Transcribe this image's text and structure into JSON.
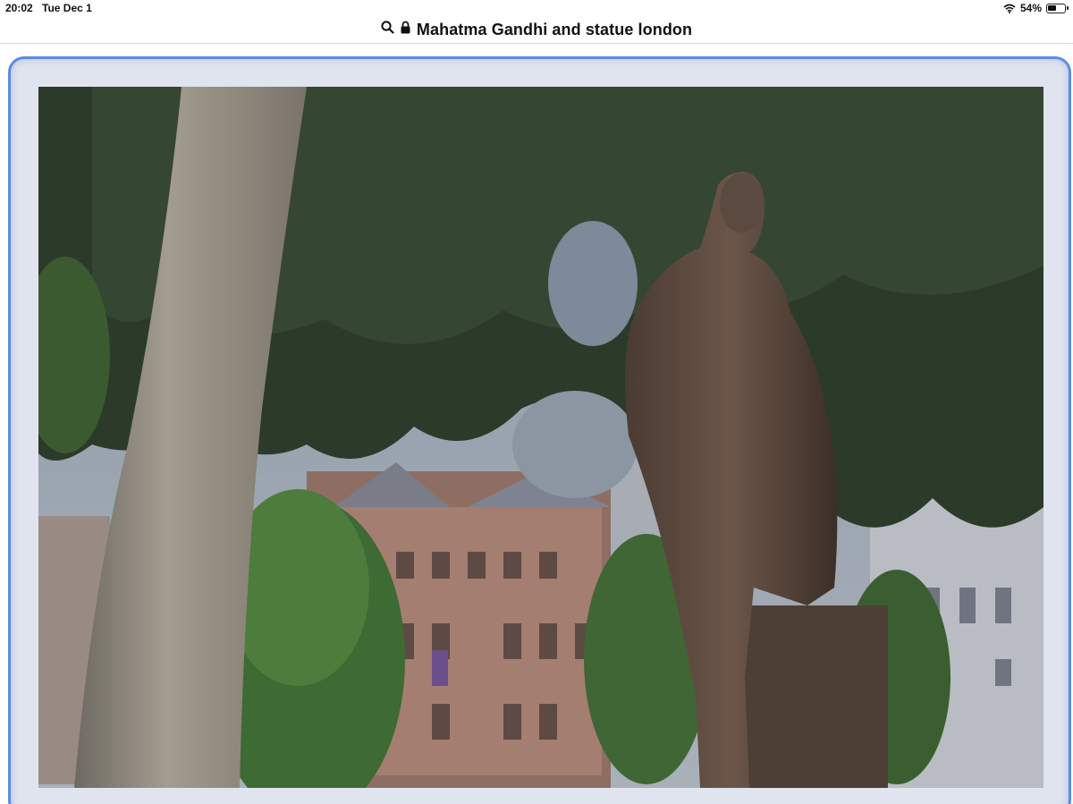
{
  "status_bar": {
    "time": "20:02",
    "date": "Tue Dec 1",
    "battery_percent_label": "54%",
    "battery_level": 0.54
  },
  "address_bar": {
    "query": "Mahatma Gandhi and statue london",
    "search_icon": "search-icon",
    "lock_icon": "lock-icon"
  },
  "image_card": {
    "accent_color": "#5b8be6",
    "photo_subject_icon": "photo-image"
  }
}
